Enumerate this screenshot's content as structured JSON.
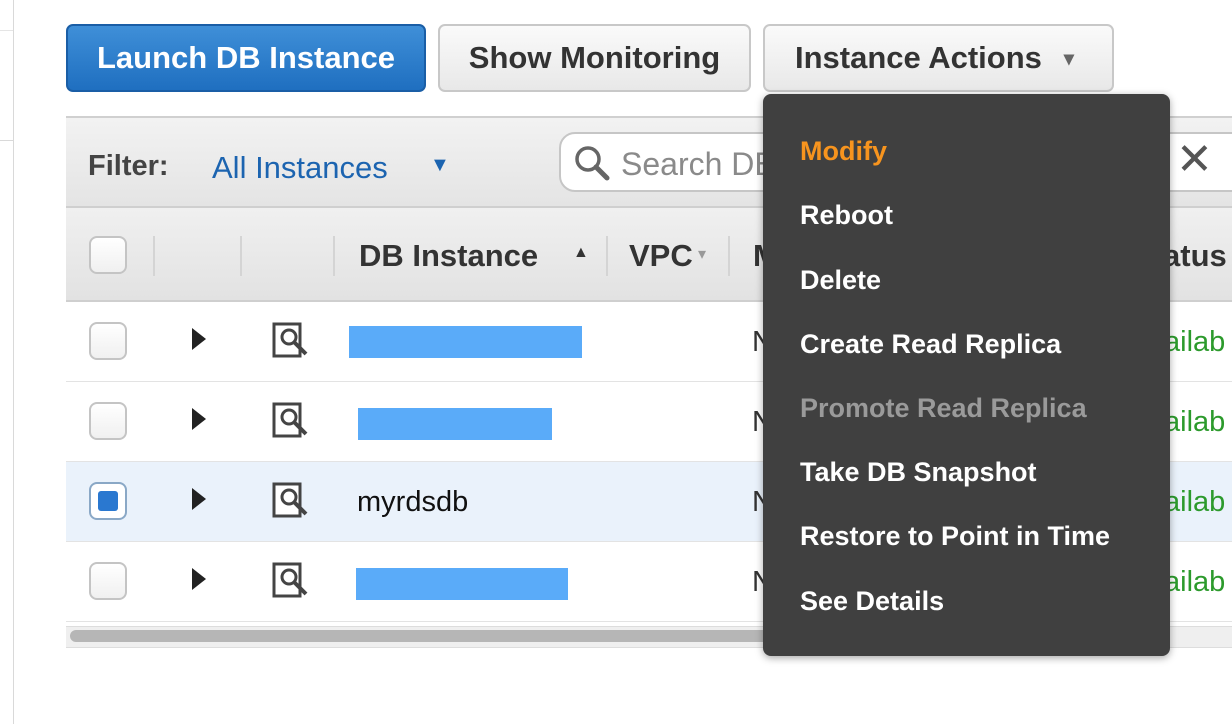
{
  "toolbar": {
    "launch_label": "Launch DB Instance",
    "monitoring_label": "Show Monitoring",
    "actions_label": "Instance Actions"
  },
  "filter": {
    "label": "Filter:",
    "value": "All Instances",
    "search_placeholder": "Search DB Instances..."
  },
  "table": {
    "headers": {
      "db_instance": "DB Instance",
      "vpc": "VPC",
      "multi_az_partial": "M",
      "status_partial": "atus"
    },
    "rows": [
      {
        "name": "",
        "redacted": true,
        "vpc": "N",
        "status": "ailab",
        "selected": false
      },
      {
        "name": "",
        "redacted": true,
        "vpc": "N",
        "status": "ailab",
        "selected": false
      },
      {
        "name": "myrdsdb",
        "redacted": false,
        "vpc": "N",
        "status": "ailab",
        "selected": true
      },
      {
        "name": "",
        "redacted": true,
        "vpc": "N",
        "status": "ailab",
        "selected": false
      }
    ]
  },
  "menu": {
    "items": [
      {
        "label": "Modify",
        "state": "active"
      },
      {
        "label": "Reboot",
        "state": "normal"
      },
      {
        "label": "Delete",
        "state": "normal"
      },
      {
        "label": "Create Read Replica",
        "state": "normal"
      },
      {
        "label": "Promote Read Replica",
        "state": "disabled"
      },
      {
        "label": "Take DB Snapshot",
        "state": "normal"
      },
      {
        "label": "Restore to Point in Time",
        "state": "normal"
      },
      {
        "label": "See Details",
        "state": "normal"
      }
    ]
  },
  "colors": {
    "primary": "#1f6fc0",
    "menu_bg": "#404040",
    "menu_active": "#f7941e",
    "status_ok": "#2c9a2c",
    "redaction": "#5aabf9"
  },
  "icons": [
    "search-icon",
    "clear-icon",
    "chevron-down-icon",
    "expand-arrow-icon",
    "inspect-icon"
  ]
}
